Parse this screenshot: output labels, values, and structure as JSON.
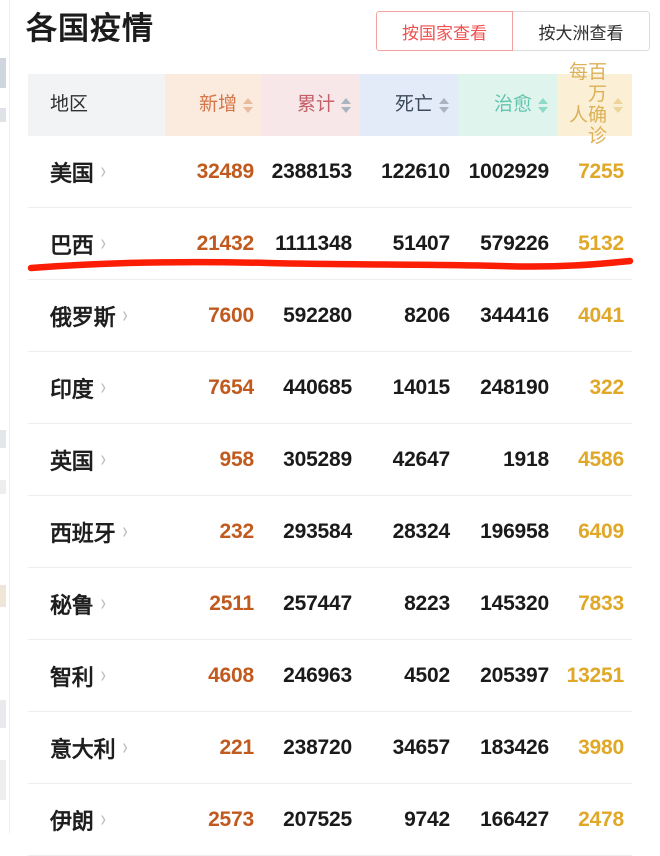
{
  "header": {
    "title": "各国疫情",
    "toggles": [
      {
        "label": "按国家查看",
        "active": true
      },
      {
        "label": "按大洲查看",
        "active": false
      }
    ]
  },
  "table": {
    "columns": [
      {
        "key": "region",
        "label": "地区",
        "sortable": false
      },
      {
        "key": "add",
        "label": "新增",
        "sortable": true
      },
      {
        "key": "total",
        "label": "累计",
        "sortable": true
      },
      {
        "key": "death",
        "label": "死亡",
        "sortable": true
      },
      {
        "key": "cured",
        "label": "治愈",
        "sortable": true
      },
      {
        "key": "permil",
        "label": "每百万\n人确诊",
        "sortable": true
      }
    ],
    "rows": [
      {
        "region": "美国",
        "add": "32489",
        "total": "2388153",
        "death": "122610",
        "cured": "1002929",
        "permil": "7255"
      },
      {
        "region": "巴西",
        "add": "21432",
        "total": "1111348",
        "death": "51407",
        "cured": "579226",
        "permil": "5132"
      },
      {
        "region": "俄罗斯",
        "add": "7600",
        "total": "592280",
        "death": "8206",
        "cured": "344416",
        "permil": "4041"
      },
      {
        "region": "印度",
        "add": "7654",
        "total": "440685",
        "death": "14015",
        "cured": "248190",
        "permil": "322"
      },
      {
        "region": "英国",
        "add": "958",
        "total": "305289",
        "death": "42647",
        "cured": "1918",
        "permil": "4586"
      },
      {
        "region": "西班牙",
        "add": "232",
        "total": "293584",
        "death": "28324",
        "cured": "196958",
        "permil": "6409"
      },
      {
        "region": "秘鲁",
        "add": "2511",
        "total": "257447",
        "death": "8223",
        "cured": "145320",
        "permil": "7833"
      },
      {
        "region": "智利",
        "add": "4608",
        "total": "246963",
        "death": "4502",
        "cured": "205397",
        "permil": "13251"
      },
      {
        "region": "意大利",
        "add": "221",
        "total": "238720",
        "death": "34657",
        "cured": "183426",
        "permil": "3980"
      },
      {
        "region": "伊朗",
        "add": "2573",
        "total": "207525",
        "death": "9742",
        "cured": "166427",
        "permil": "2478"
      }
    ],
    "row_chevron": "›"
  },
  "annotation": {
    "type": "handdrawn-underline",
    "target_row": "巴西",
    "color": "#fc1d05"
  }
}
